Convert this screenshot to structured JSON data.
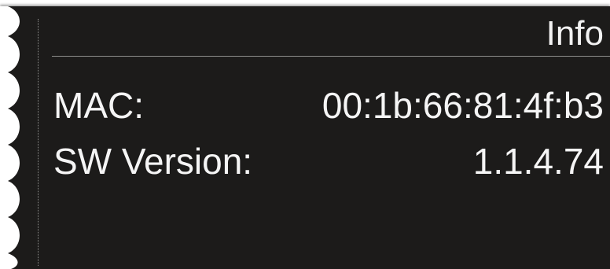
{
  "panel": {
    "title": "Info",
    "background_color": "#1c1b1a",
    "text_color": "#f5f5f5",
    "left_edge_icon": "torn-edge-decoration"
  },
  "info_rows": [
    {
      "label": "MAC:",
      "value": "00:1b:66:81:4f:b3"
    },
    {
      "label": "SW Version:",
      "value": "1.1.4.74"
    }
  ]
}
